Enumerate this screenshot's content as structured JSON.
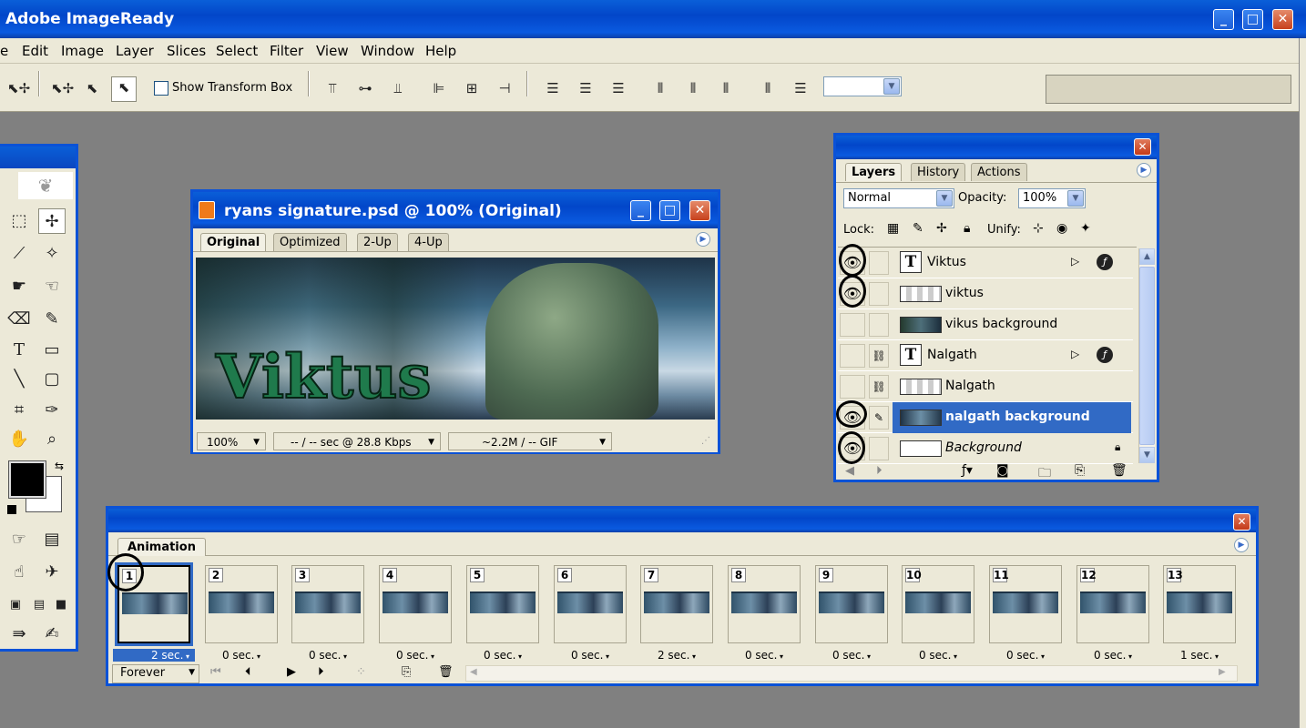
{
  "app": {
    "title": "Adobe ImageReady"
  },
  "window_controls": {
    "minimize": "_",
    "maximize": "□",
    "close": "✕"
  },
  "menu": [
    {
      "label": "e"
    },
    {
      "label": "Edit"
    },
    {
      "label": "Image"
    },
    {
      "label": "Layer"
    },
    {
      "label": "Slices"
    },
    {
      "label": "Select"
    },
    {
      "label": "Filter"
    },
    {
      "label": "View"
    },
    {
      "label": "Window"
    },
    {
      "label": "Help"
    }
  ],
  "options_bar": {
    "show_transform_box": "Show Transform Box",
    "show_transform_box_checked": false
  },
  "document": {
    "title": "ryans signature.psd @ 100% (Original)",
    "tabs": [
      "Original",
      "Optimized",
      "2-Up",
      "4-Up"
    ],
    "active_tab": "Original",
    "artwork_text": "Viktus",
    "zoom": "100%",
    "download_time": "-- / -- sec @ 28.8 Kbps",
    "file_info": "~2.2M / -- GIF"
  },
  "layers_panel": {
    "tabs": [
      "Layers",
      "History",
      "Actions"
    ],
    "active_tab": "Layers",
    "blend_mode": "Normal",
    "opacity_label": "Opacity:",
    "opacity": "100%",
    "lock_label": "Lock:",
    "unify_label": "Unify:",
    "layers": [
      {
        "name": "Viktus",
        "kind": "text",
        "visible": true,
        "linked": false,
        "selected": false
      },
      {
        "name": "viktus",
        "kind": "image",
        "visible": true,
        "linked": false,
        "selected": false
      },
      {
        "name": "vikus background",
        "kind": "image",
        "visible": false,
        "linked": false,
        "selected": false
      },
      {
        "name": "Nalgath",
        "kind": "text",
        "visible": false,
        "linked": true,
        "selected": false
      },
      {
        "name": "Nalgath",
        "kind": "image",
        "visible": false,
        "linked": true,
        "selected": false
      },
      {
        "name": "nalgath background",
        "kind": "image",
        "visible": true,
        "linked": false,
        "selected": true
      },
      {
        "name": "Background",
        "kind": "background",
        "visible": true,
        "linked": false,
        "selected": false
      }
    ],
    "text_layer_glyph": "T"
  },
  "animation_panel": {
    "tab": "Animation",
    "loop": "Forever",
    "selected_frame": 1,
    "frames": [
      {
        "number": "1",
        "delay": "2 sec."
      },
      {
        "number": "2",
        "delay": "0 sec."
      },
      {
        "number": "3",
        "delay": "0 sec."
      },
      {
        "number": "4",
        "delay": "0 sec."
      },
      {
        "number": "5",
        "delay": "0 sec."
      },
      {
        "number": "6",
        "delay": "0 sec."
      },
      {
        "number": "7",
        "delay": "2 sec."
      },
      {
        "number": "8",
        "delay": "0 sec."
      },
      {
        "number": "9",
        "delay": "0 sec."
      },
      {
        "number": "10",
        "delay": "0 sec."
      },
      {
        "number": "11",
        "delay": "0 sec."
      },
      {
        "number": "12",
        "delay": "0 sec."
      },
      {
        "number": "13",
        "delay": "1 sec."
      }
    ]
  },
  "colors": {
    "xp_blue": "#0b52d6",
    "selection_blue": "#316ac5",
    "panel_bg": "#ece9d8",
    "workspace_gray": "#808080",
    "artwork_text_green": "#1f7a4c"
  }
}
